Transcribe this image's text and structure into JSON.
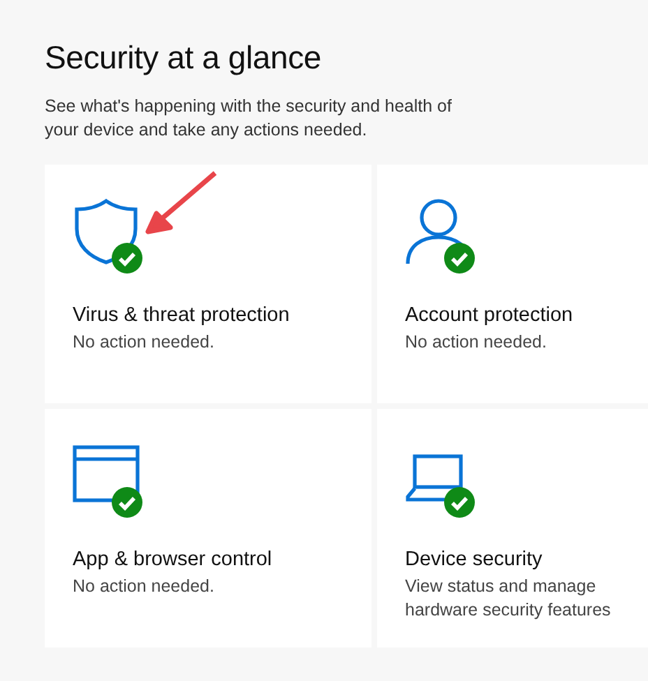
{
  "title": "Security at a glance",
  "subtitle": "See what's happening with the security and health of your device and take any actions needed.",
  "tiles": [
    {
      "kind": "shield",
      "pointer": true,
      "label": "Virus & threat protection",
      "status": "No action needed."
    },
    {
      "kind": "person",
      "pointer": false,
      "label": "Account protection",
      "status": "No action needed."
    },
    {
      "kind": "window",
      "pointer": false,
      "label": "App & browser control",
      "status": "No action needed."
    },
    {
      "kind": "laptop",
      "pointer": false,
      "label": "Device security",
      "status": "View status and manage hardware security features"
    }
  ]
}
